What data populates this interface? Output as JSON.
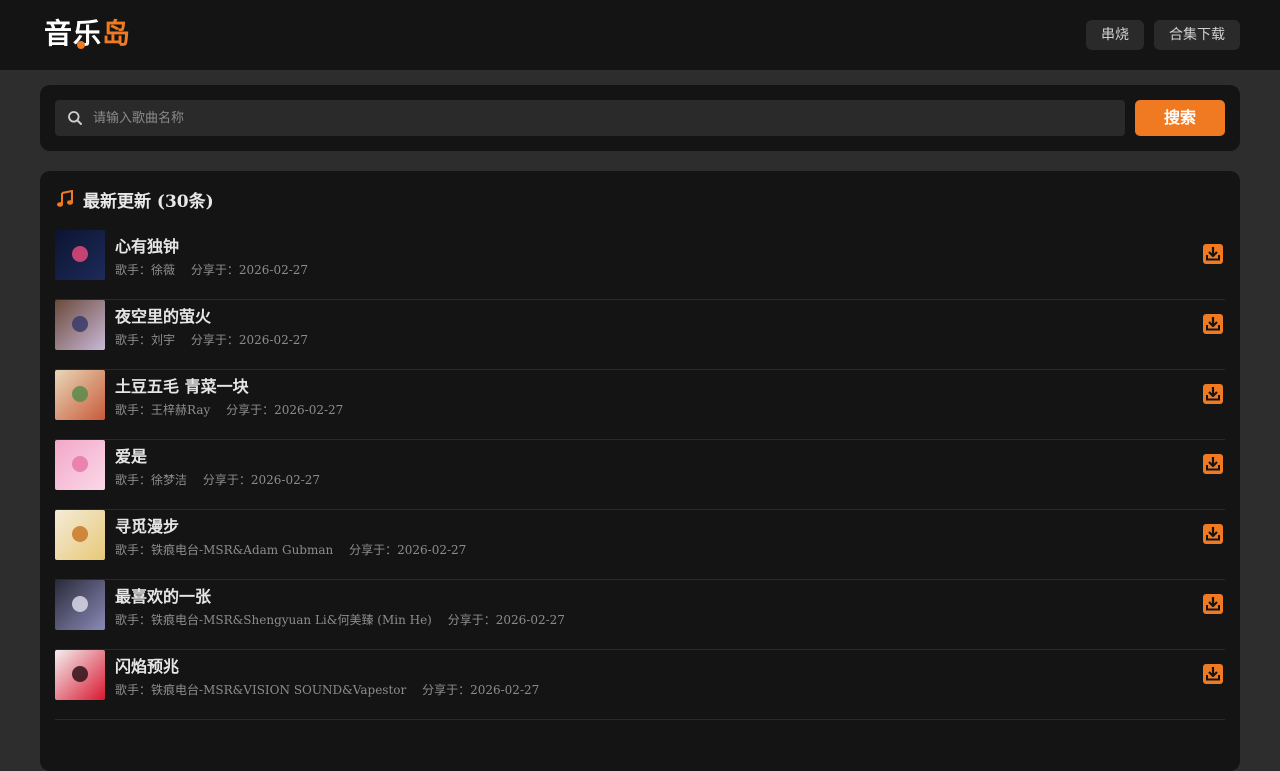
{
  "brand": {
    "part1": "音",
    "part2": "乐",
    "part3": "岛",
    "accent": "#f07a22"
  },
  "nav": {
    "medley": "串烧",
    "collection_download": "合集下载"
  },
  "search": {
    "placeholder": "请输入歌曲名称",
    "value": "",
    "button": "搜索"
  },
  "list": {
    "title": "最新更新 (30条)",
    "singer_prefix": "歌手：",
    "shared_prefix": "分享于：",
    "songs": [
      {
        "title": "心有独钟",
        "singer": "徐薇",
        "date": "2026-02-27",
        "cover": [
          "#0b1430",
          "#1e2a5a",
          "#e24a7a"
        ]
      },
      {
        "title": "夜空里的萤火",
        "singer": "刘宇",
        "date": "2026-02-27",
        "cover": [
          "#6a4a3a",
          "#c9b8d8",
          "#3a3a6a"
        ]
      },
      {
        "title": "土豆五毛 青菜一块",
        "singer": "王梓赫Ray",
        "date": "2026-02-27",
        "cover": [
          "#e8d8b8",
          "#c85a3a",
          "#5a8a4a"
        ]
      },
      {
        "title": "爱是",
        "singer": "徐梦洁",
        "date": "2026-02-27",
        "cover": [
          "#f2a8c8",
          "#fbd8e8",
          "#e878a8"
        ]
      },
      {
        "title": "寻觅漫步",
        "singer": "铁痕电台-MSR&Adam Gubman",
        "date": "2026-02-27",
        "cover": [
          "#f4ecd8",
          "#e8c878",
          "#c87828"
        ]
      },
      {
        "title": "最喜欢的一张",
        "singer": "铁痕电台-MSR&Shengyuan Li&何美臻 (Min He)",
        "date": "2026-02-27",
        "cover": [
          "#2a2a3a",
          "#8a8ab8",
          "#d8d8e8"
        ]
      },
      {
        "title": "闪焰预兆",
        "singer": "铁痕电台-MSR&VISION SOUND&Vapestor",
        "date": "2026-02-27",
        "cover": [
          "#f4f0f0",
          "#d81830",
          "#301018"
        ]
      }
    ]
  }
}
